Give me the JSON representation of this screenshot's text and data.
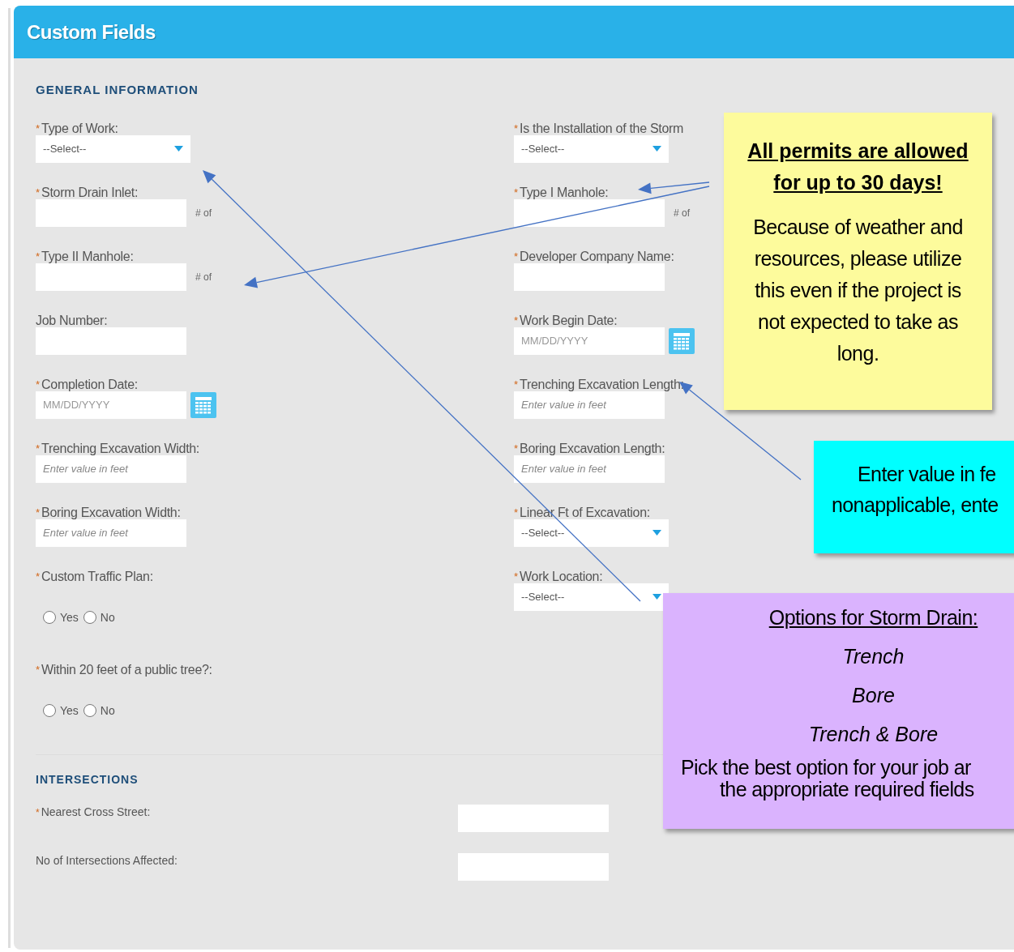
{
  "panel": {
    "title": "Custom Fields"
  },
  "required_marker": "*",
  "general": {
    "title": "GENERAL INFORMATION",
    "left": [
      {
        "kind": "select",
        "label": "Type of Work:",
        "required": true,
        "value": "--Select--"
      },
      {
        "kind": "number",
        "label": "Storm Drain Inlet:",
        "required": true,
        "unit": "# of"
      },
      {
        "kind": "number",
        "label": "Type II Manhole:",
        "required": true,
        "unit": "# of"
      },
      {
        "kind": "text",
        "label": "Job Number:",
        "required": false
      },
      {
        "kind": "date",
        "label": "Completion Date:",
        "required": true,
        "placeholder": "MM/DD/YYYY"
      },
      {
        "kind": "text",
        "label": "Trenching Excavation Width:",
        "required": true,
        "placeholder": "Enter value in feet"
      },
      {
        "kind": "text",
        "label": "Boring Excavation Width:",
        "required": true,
        "placeholder": "Enter value in feet"
      },
      {
        "kind": "radio",
        "label": "Custom Traffic Plan:",
        "required": true,
        "options": [
          {
            "label": "Yes",
            "selected": false
          },
          {
            "label": "No",
            "selected": false
          }
        ]
      },
      {
        "kind": "radio",
        "label": "Within 20 feet of a public tree?:",
        "required": true,
        "options": [
          {
            "label": "Yes",
            "selected": false
          },
          {
            "label": "No",
            "selected": false
          }
        ]
      }
    ],
    "right": [
      {
        "kind": "select",
        "label": "Is the Installation of the Storm",
        "required": true,
        "value": "--Select--"
      },
      {
        "kind": "number",
        "label": "Type I Manhole:",
        "required": true,
        "unit": "# of"
      },
      {
        "kind": "text",
        "label": "Developer Company Name:",
        "required": true
      },
      {
        "kind": "date",
        "label": "Work Begin Date:",
        "required": true,
        "placeholder": "MM/DD/YYYY"
      },
      {
        "kind": "text",
        "label": "Trenching Excavation Length:",
        "required": true,
        "placeholder": "Enter value in feet"
      },
      {
        "kind": "text",
        "label": "Boring Excavation Length:",
        "required": true,
        "placeholder": "Enter value in feet"
      },
      {
        "kind": "select",
        "label": "Linear Ft of Excavation:",
        "required": true,
        "value": "--Select--"
      },
      {
        "kind": "select",
        "label": "Work Location:",
        "required": true,
        "value": "--Select--"
      }
    ]
  },
  "intersections": {
    "title": "INTERSECTIONS",
    "fields": [
      {
        "label": "Nearest Cross Street:",
        "required": true
      },
      {
        "label": "No of Intersections Affected:",
        "required": false
      }
    ]
  },
  "notes": [
    {
      "kind": "yellow",
      "heading": "All permits are allowed for up to 30 days!",
      "lines": [
        "Because of weather and resources, please utilize this even if the project is not expected to take as long."
      ]
    },
    {
      "kind": "cyan",
      "lines": [
        "Enter value in fe",
        "nonapplicable, ente"
      ]
    },
    {
      "kind": "purple",
      "heading": "Options for Storm Drain:",
      "options": [
        "Trench",
        "Bore",
        "Trench & Bore"
      ],
      "lines": [
        "Pick the best option for your job ar",
        "the appropriate required fields"
      ]
    }
  ]
}
